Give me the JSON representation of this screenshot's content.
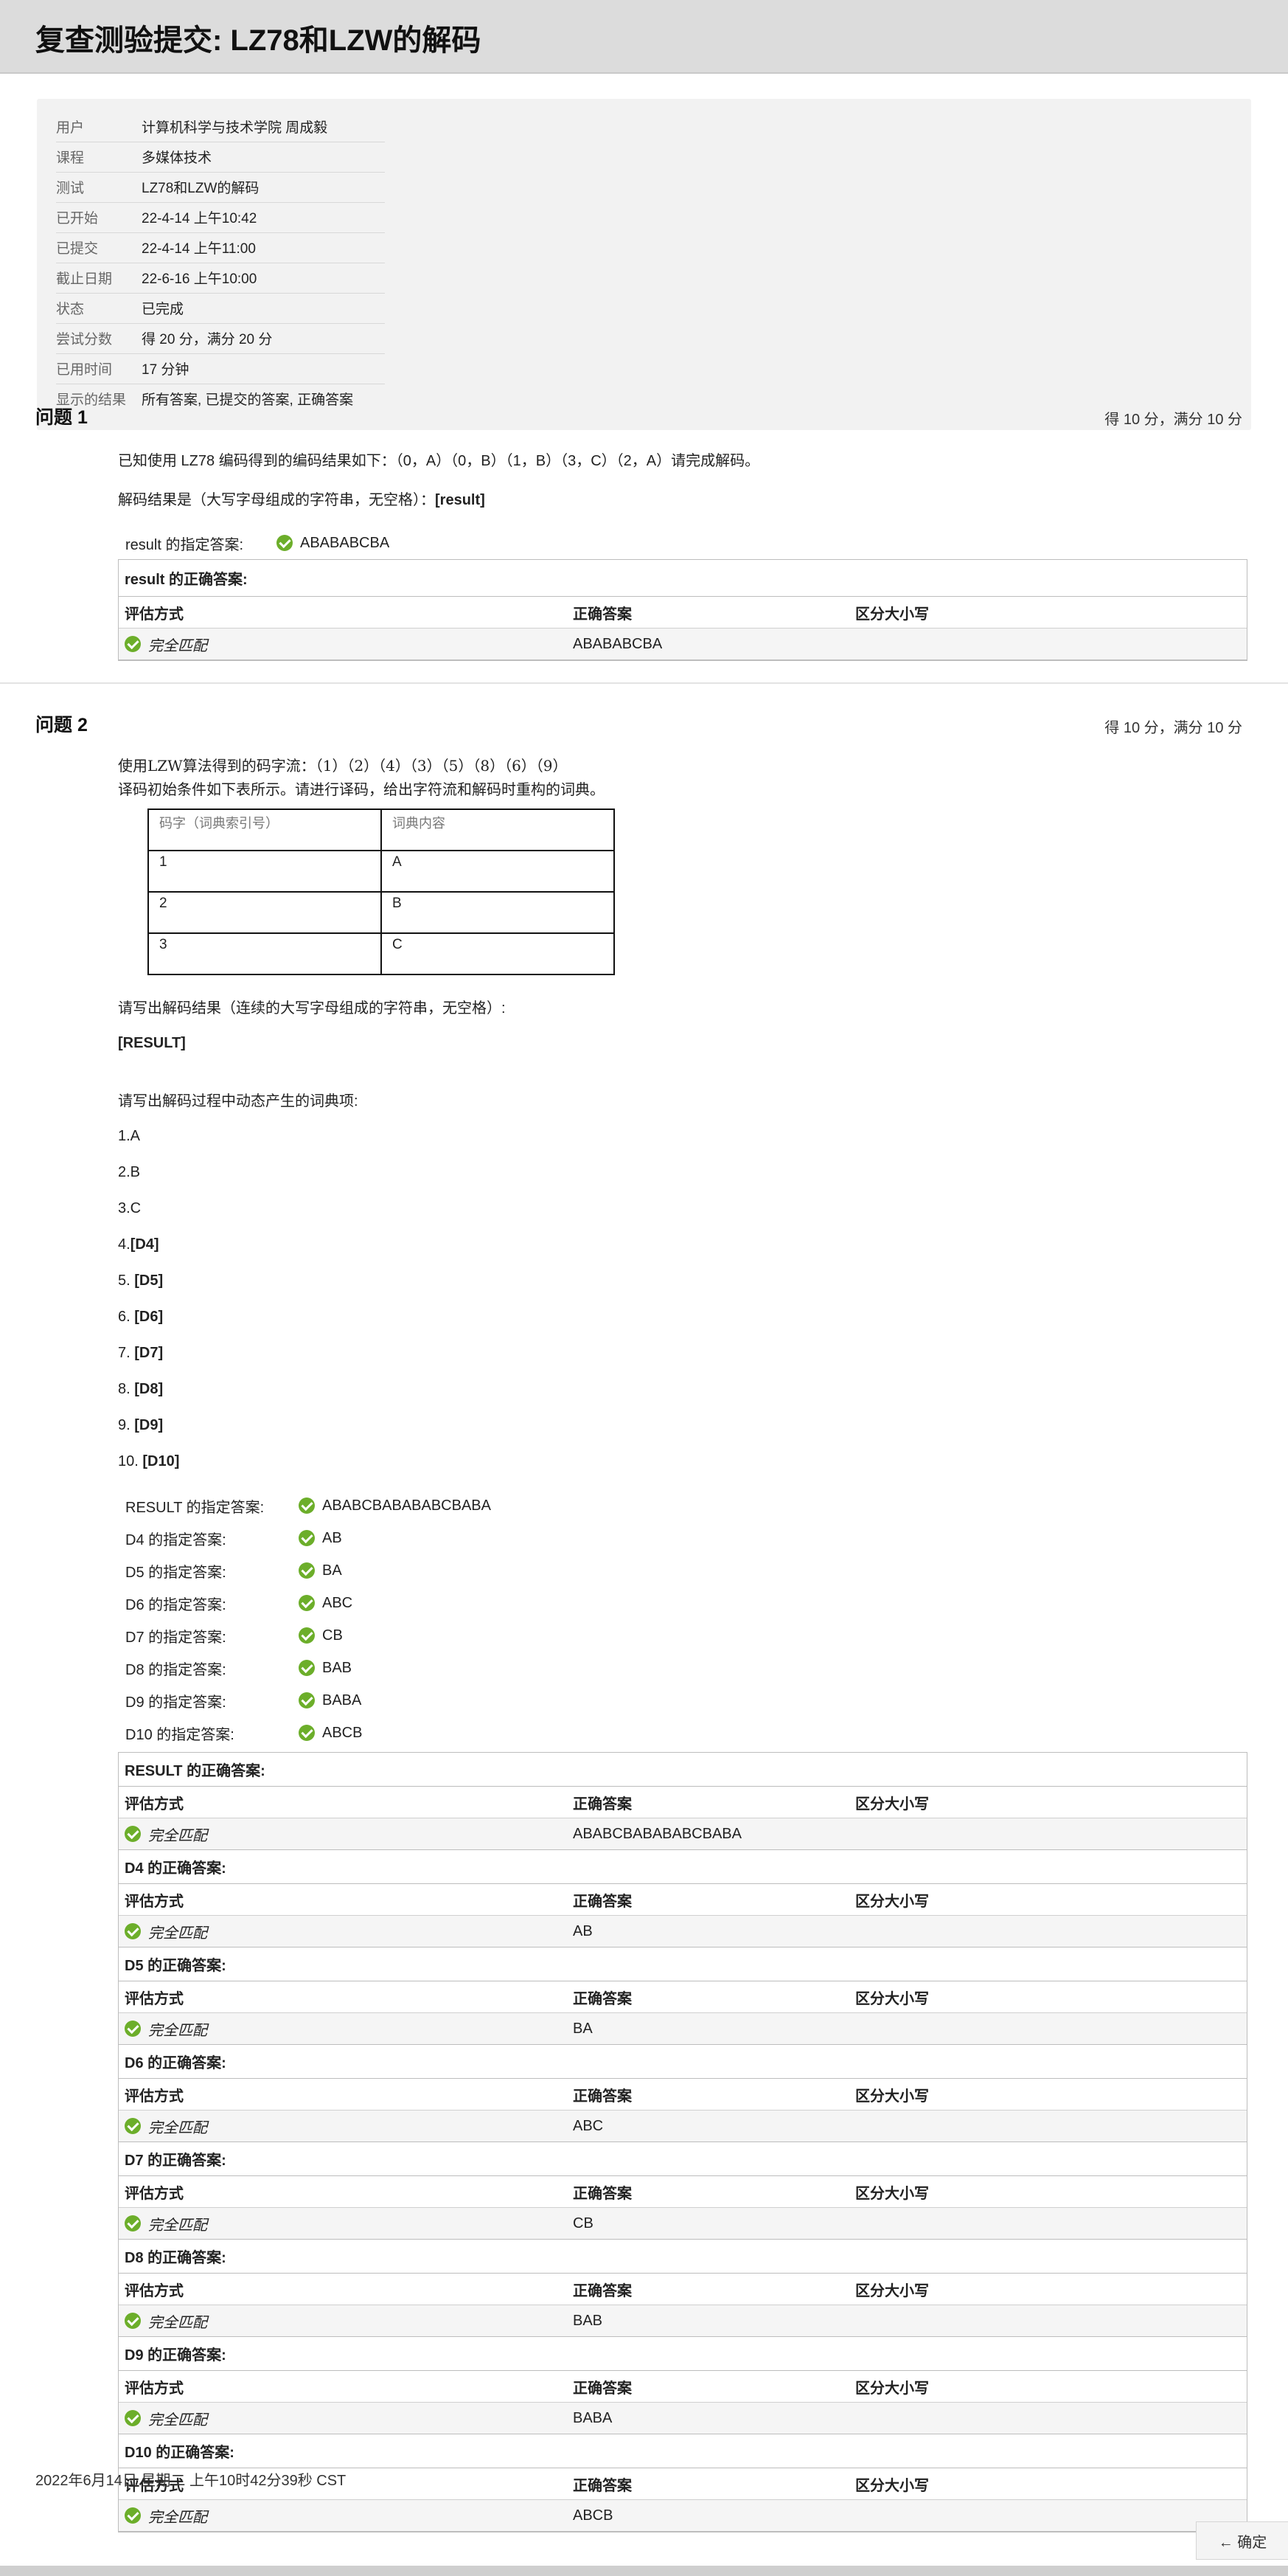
{
  "page": {
    "title": "复查测验提交: LZ78和LZW的解码",
    "footer_date": "2022年6月14日 星期二 上午10时42分39秒 CST",
    "ok_label": "← 确定"
  },
  "summary": [
    {
      "k": "用户",
      "v": "计算机科学与技术学院 周成毅"
    },
    {
      "k": "课程",
      "v": "多媒体技术"
    },
    {
      "k": "测试",
      "v": "LZ78和LZW的解码"
    },
    {
      "k": "已开始",
      "v": "22-4-14 上午10:42"
    },
    {
      "k": "已提交",
      "v": "22-4-14 上午11:00"
    },
    {
      "k": "截止日期",
      "v": "22-6-16 上午10:00"
    },
    {
      "k": "状态",
      "v": "已完成"
    },
    {
      "k": "尝试分数",
      "v": "得 20 分，满分 20 分"
    },
    {
      "k": "已用时间",
      "v": "17 分钟"
    },
    {
      "k": "显示的结果",
      "v": "所有答案, 已提交的答案, 正确答案"
    }
  ],
  "table_headers": {
    "method": "评估方式",
    "correct": "正确答案",
    "case": "区分大小写"
  },
  "match_label": "完全匹配",
  "q1": {
    "title": "问题 1",
    "score": "得 10 分，满分 10 分",
    "text1": "已知使用 LZ78 编码得到的编码结果如下：（0，A）（0，B）（1，B）（3，C）（2，A）请完成解码。",
    "text2": "解码结果是（大写字母组成的字符串，无空格）：",
    "text2_tag": "[result]",
    "given_label": "result 的指定答案:",
    "given_value": "ABABABCBA",
    "correct_header": "result 的正确答案:",
    "correct_value": "ABABABCBA"
  },
  "q2": {
    "title": "问题 2",
    "score": "得 10 分，满分 10 分",
    "line1": "使用LZW算法得到的码字流：（1）（2）（4）（3）（5）（8）（6）（9）",
    "line2": "译码初始条件如下表所示。请进行译码，给出字符流和解码时重构的词典。",
    "dict_header": [
      "码字（词典索引号）",
      "词典内容"
    ],
    "dict_rows": [
      [
        "1",
        "A"
      ],
      [
        "2",
        "B"
      ],
      [
        "3",
        "C"
      ]
    ],
    "ask_result": "请写出解码结果（连续的大写字母组成的字符串，无空格）:",
    "result_tag": "[RESULT]",
    "ask_dict": "请写出解码过程中动态产生的词典项:",
    "entries": [
      {
        "n": "1.A",
        "t": ""
      },
      {
        "n": "2.B",
        "t": ""
      },
      {
        "n": "3.C",
        "t": ""
      },
      {
        "n": "4.",
        "t": "[D4]"
      },
      {
        "n": "5. ",
        "t": "[D5]"
      },
      {
        "n": "6. ",
        "t": "[D6]"
      },
      {
        "n": "7. ",
        "t": "[D7]"
      },
      {
        "n": "8. ",
        "t": "[D8]"
      },
      {
        "n": "9. ",
        "t": "[D9]"
      },
      {
        "n": "10. ",
        "t": "[D10]"
      }
    ],
    "given": [
      {
        "label": "RESULT 的指定答案:",
        "value": "ABABCBABABABCBABA"
      },
      {
        "label": "D4 的指定答案:",
        "value": "AB"
      },
      {
        "label": "D5 的指定答案:",
        "value": "BA"
      },
      {
        "label": "D6 的指定答案:",
        "value": "ABC"
      },
      {
        "label": "D7 的指定答案:",
        "value": "CB"
      },
      {
        "label": "D8 的指定答案:",
        "value": "BAB"
      },
      {
        "label": "D9 的指定答案:",
        "value": "BABA"
      },
      {
        "label": "D10 的指定答案:",
        "value": "ABCB"
      }
    ],
    "correct": [
      {
        "header": "RESULT 的正确答案:",
        "value": "ABABCBABABABCBABA"
      },
      {
        "header": "D4 的正确答案:",
        "value": "AB"
      },
      {
        "header": "D5 的正确答案:",
        "value": "BA"
      },
      {
        "header": "D6 的正确答案:",
        "value": "ABC"
      },
      {
        "header": "D7 的正确答案:",
        "value": "CB"
      },
      {
        "header": "D8 的正确答案:",
        "value": "BAB"
      },
      {
        "header": "D9 的正确答案:",
        "value": "BABA"
      },
      {
        "header": "D10 的正确答案:",
        "value": "ABCB"
      }
    ]
  },
  "colors": {
    "check": "#6cae2a",
    "header_bg": "#dcdcdc",
    "summary_bg": "#f2f2f2"
  }
}
